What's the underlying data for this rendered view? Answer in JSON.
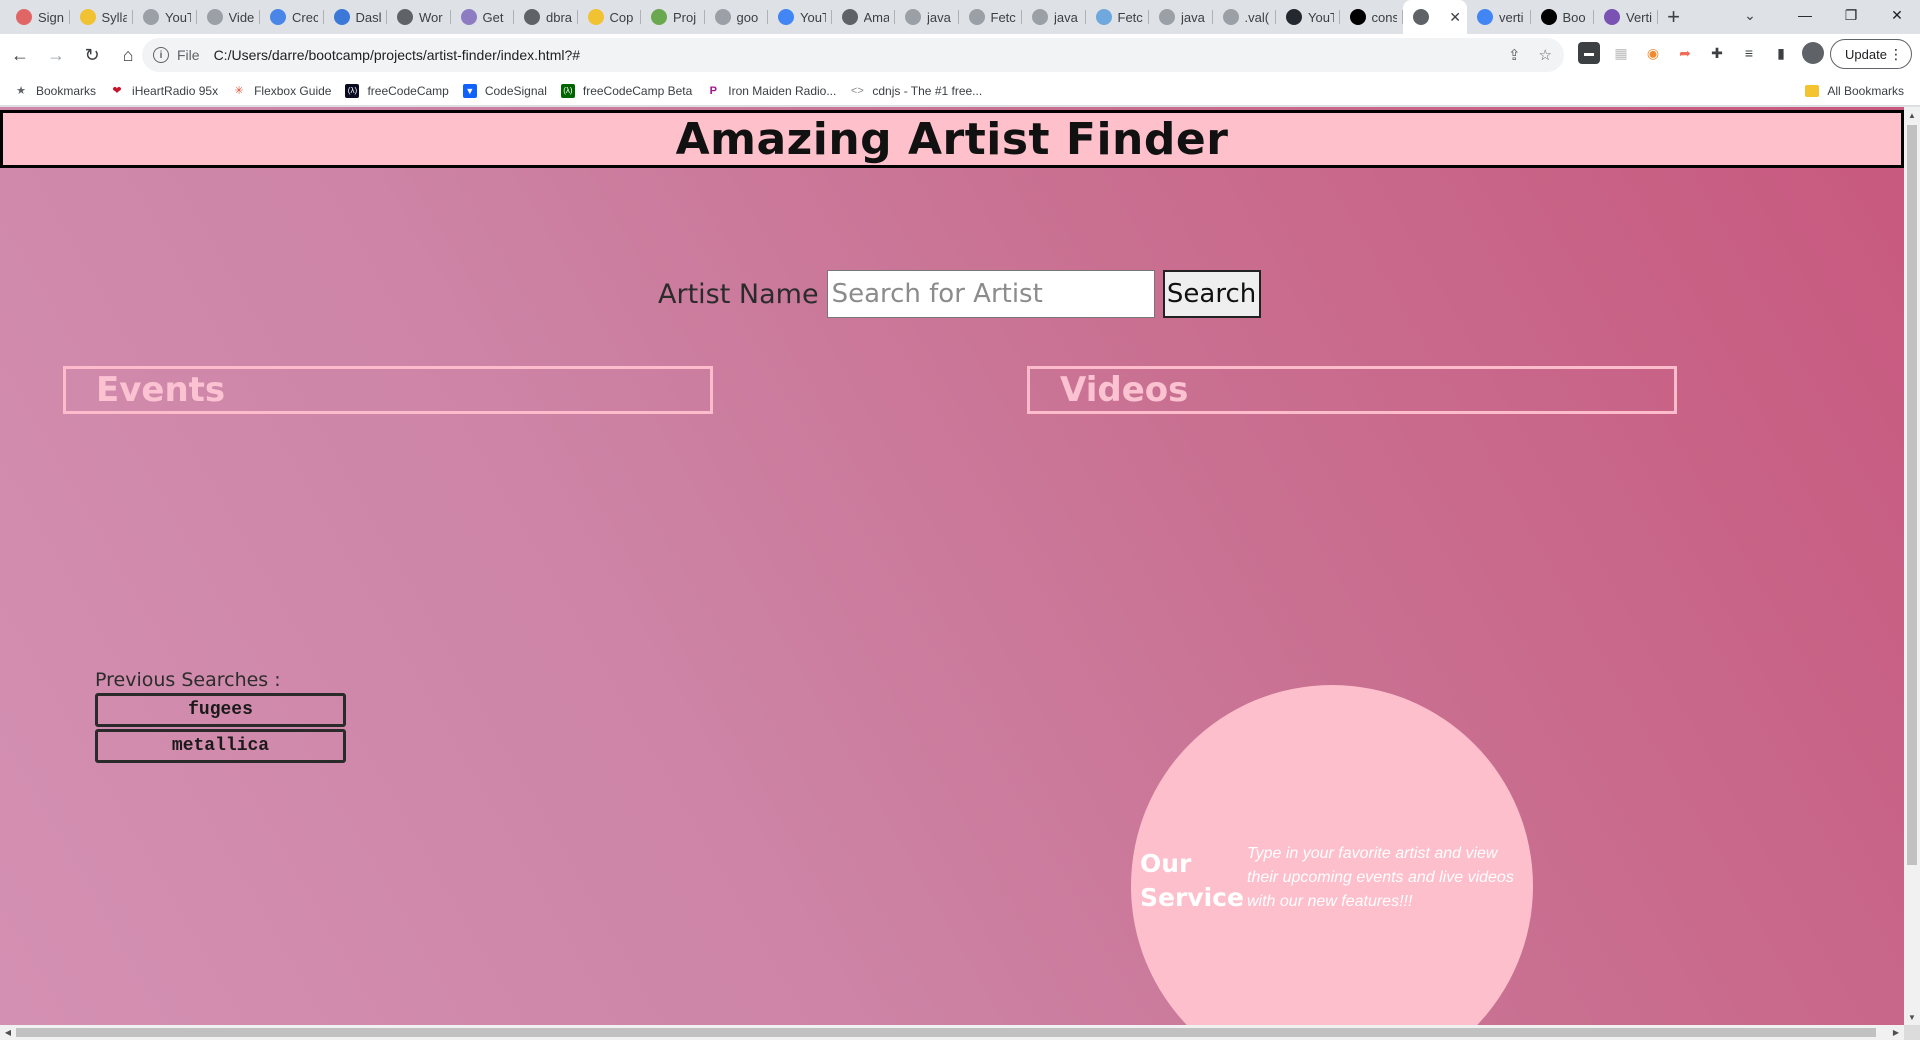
{
  "browser": {
    "tabs": [
      {
        "label": "Sign",
        "color": "#e06666"
      },
      {
        "label": "Sylla",
        "color": "#f1c232"
      },
      {
        "label": "YouT",
        "color": "#9aa0a6"
      },
      {
        "label": "Vide",
        "color": "#9aa0a6"
      },
      {
        "label": "Crec",
        "color": "#4a86e8"
      },
      {
        "label": "Dasl",
        "color": "#3c78d8"
      },
      {
        "label": "Wor",
        "color": "#5f6368"
      },
      {
        "label": "Get",
        "color": "#8e7cc3"
      },
      {
        "label": "dbra",
        "color": "#5f6368"
      },
      {
        "label": "Cop",
        "color": "#f1c232"
      },
      {
        "label": "Proj",
        "color": "#6aa84f"
      },
      {
        "label": "goo",
        "color": "#9aa0a6"
      },
      {
        "label": "YouT",
        "color": "#4285f4"
      },
      {
        "label": "Ama",
        "color": "#5f6368"
      },
      {
        "label": "java",
        "color": "#9aa0a6"
      },
      {
        "label": "Fetc",
        "color": "#9aa0a6"
      },
      {
        "label": "java",
        "color": "#9aa0a6"
      },
      {
        "label": "Fetc",
        "color": "#6fa8dc"
      },
      {
        "label": "java",
        "color": "#9aa0a6"
      },
      {
        "label": ".val(",
        "color": "#9aa0a6"
      },
      {
        "label": "YouT",
        "color": "#24292f"
      },
      {
        "label": "cons",
        "color": "#000000"
      },
      {
        "label": "",
        "color": "#5f6368",
        "active": true
      },
      {
        "label": "verti",
        "color": "#4285f4"
      },
      {
        "label": "Boo",
        "color": "#000000"
      },
      {
        "label": "Verti",
        "color": "#7952b3"
      }
    ],
    "address": {
      "scheme": "File",
      "url": "C:/Users/darre/bootcamp/projects/artist-finder/index.html?#"
    },
    "update_label": "Update",
    "bookmarks": [
      {
        "label": "Bookmarks",
        "icon": "star-icon"
      },
      {
        "label": "iHeartRadio 95x",
        "icon": "heart-icon"
      },
      {
        "label": "Flexbox Guide",
        "icon": "asterisk-icon"
      },
      {
        "label": "freeCodeCamp",
        "icon": "fcc-icon"
      },
      {
        "label": "CodeSignal",
        "icon": "codesignal-icon"
      },
      {
        "label": "freeCodeCamp Beta",
        "icon": "fcc-beta-icon"
      },
      {
        "label": "Iron Maiden Radio...",
        "icon": "pandora-icon"
      },
      {
        "label": "cdnjs - The #1 free...",
        "icon": "code-icon"
      }
    ],
    "all_bookmarks_label": "All Bookmarks"
  },
  "page": {
    "title": "Amazing Artist Finder",
    "search": {
      "label": "Artist Name",
      "placeholder": "Search for Artist",
      "value": "",
      "button_label": "Search"
    },
    "events_title": "Events",
    "videos_title": "Videos",
    "previous_searches": {
      "label": "Previous Searches :",
      "items": [
        "fugees",
        "metallica"
      ]
    },
    "service": {
      "title": "Our Service",
      "text": "Type in your favorite artist and view their upcoming events and live videos with our new features!!!"
    }
  },
  "colors": {
    "header_bg": "#fec0cb",
    "panel_border": "#fdbccc",
    "circle": "#fdbfcb",
    "gradient_start": "#d490b2",
    "gradient_end": "#c8587e"
  }
}
